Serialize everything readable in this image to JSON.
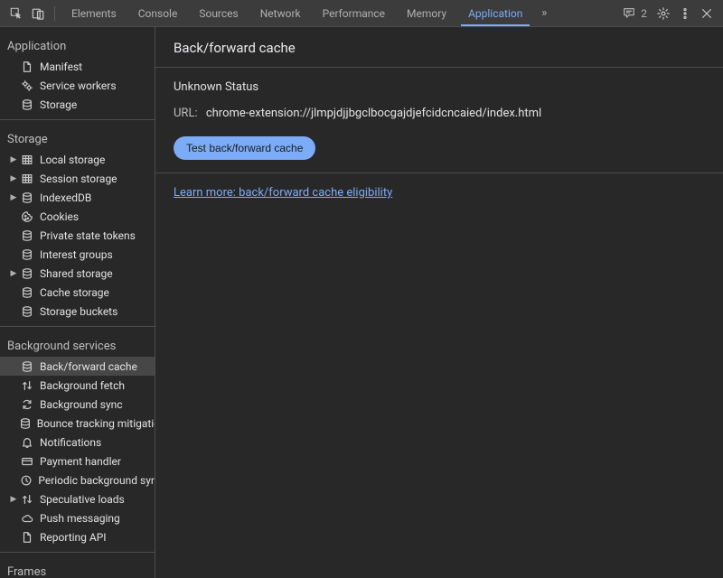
{
  "tabs": {
    "items": [
      "Elements",
      "Console",
      "Sources",
      "Network",
      "Performance",
      "Memory",
      "Application"
    ],
    "active_index": 6,
    "overflow_label": "»",
    "message_count": "2"
  },
  "sidebar": {
    "sections": [
      {
        "title": "Application",
        "items": [
          {
            "icon": "file",
            "label": "Manifest",
            "expandable": false
          },
          {
            "icon": "gears",
            "label": "Service workers",
            "expandable": false
          },
          {
            "icon": "db",
            "label": "Storage",
            "expandable": false
          }
        ]
      },
      {
        "title": "Storage",
        "items": [
          {
            "icon": "grid",
            "label": "Local storage",
            "expandable": true
          },
          {
            "icon": "grid",
            "label": "Session storage",
            "expandable": true
          },
          {
            "icon": "db",
            "label": "IndexedDB",
            "expandable": true
          },
          {
            "icon": "cookie",
            "label": "Cookies",
            "expandable": false
          },
          {
            "icon": "db",
            "label": "Private state tokens",
            "expandable": false
          },
          {
            "icon": "db",
            "label": "Interest groups",
            "expandable": false
          },
          {
            "icon": "db",
            "label": "Shared storage",
            "expandable": true
          },
          {
            "icon": "db",
            "label": "Cache storage",
            "expandable": false
          },
          {
            "icon": "db",
            "label": "Storage buckets",
            "expandable": false
          }
        ]
      },
      {
        "title": "Background services",
        "items": [
          {
            "icon": "db",
            "label": "Back/forward cache",
            "expandable": false,
            "selected": true
          },
          {
            "icon": "updown",
            "label": "Background fetch",
            "expandable": false
          },
          {
            "icon": "sync",
            "label": "Background sync",
            "expandable": false
          },
          {
            "icon": "db",
            "label": "Bounce tracking mitigations",
            "expandable": false
          },
          {
            "icon": "bell",
            "label": "Notifications",
            "expandable": false
          },
          {
            "icon": "card",
            "label": "Payment handler",
            "expandable": false
          },
          {
            "icon": "clock",
            "label": "Periodic background sync",
            "expandable": false
          },
          {
            "icon": "updown",
            "label": "Speculative loads",
            "expandable": true
          },
          {
            "icon": "cloud",
            "label": "Push messaging",
            "expandable": false
          },
          {
            "icon": "file",
            "label": "Reporting API",
            "expandable": false
          }
        ]
      },
      {
        "title": "Frames",
        "items": []
      }
    ]
  },
  "content": {
    "title": "Back/forward cache",
    "status": "Unknown Status",
    "url_label": "URL:",
    "url_value": "chrome-extension://jlmpjdjjbgclbocgajdjefcidcncaied/index.html",
    "test_button": "Test back/forward cache",
    "learn_more": "Learn more: back/forward cache eligibility"
  }
}
